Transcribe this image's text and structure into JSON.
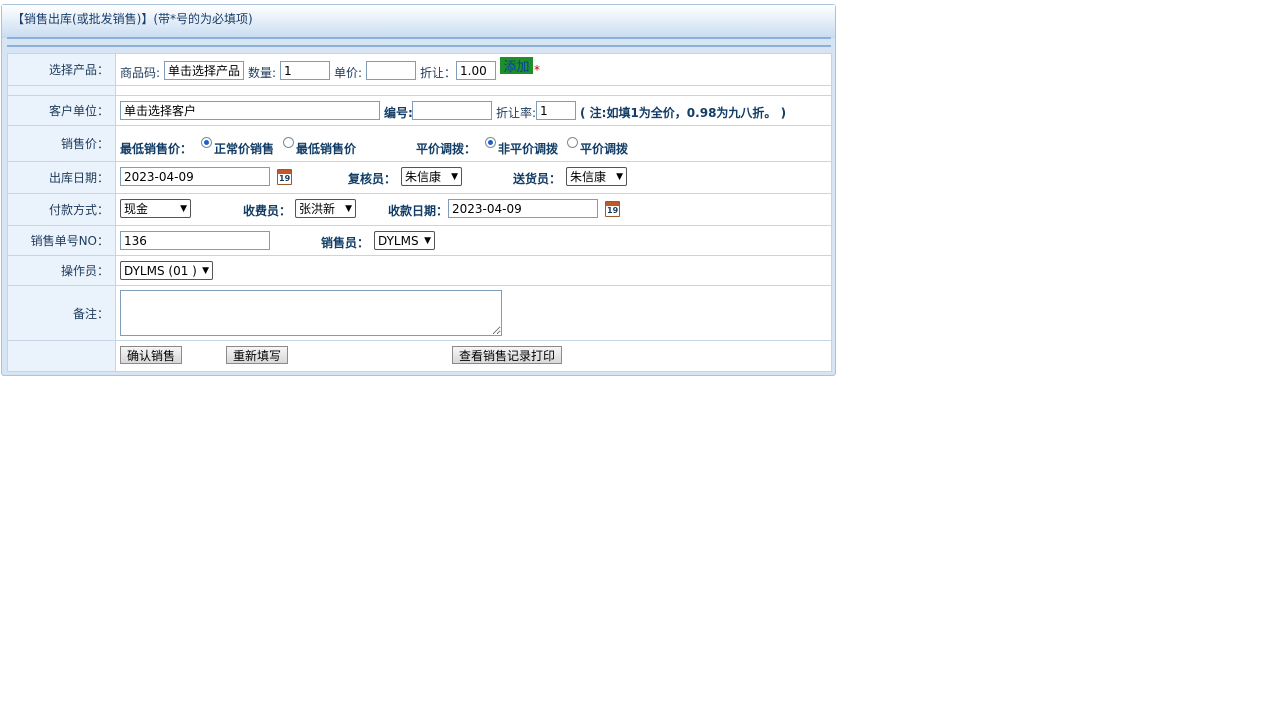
{
  "header": {
    "title": "【销售出库(或批发销售)】(带*号的为必填项)"
  },
  "rows": {
    "product": {
      "label": "选择产品：",
      "code_label": "商品码:",
      "code_value": "单击选择产品",
      "qty_label": "数量:",
      "qty_value": "1",
      "price_label": "单价:",
      "price_value": "",
      "discount_label": "折让：",
      "discount_value": "1.00",
      "add_label": "添加",
      "required_mark": "*"
    },
    "customer": {
      "label": "客户单位：",
      "value": "单击选择客户",
      "code_label": "编号:",
      "code_value": "",
      "rate_label": "折让率:",
      "rate_value": "1",
      "note": "( 注:如填1为全价，0.98为九八折。 )"
    },
    "sale_price": {
      "label": "销售价：",
      "min_label": "最低销售价：",
      "opt_normal": "正常价销售",
      "opt_min": "最低销售价",
      "transfer_label": "平价调拨：",
      "opt_nontransfer": "非平价调拨",
      "opt_transfer": "平价调拨"
    },
    "out_date": {
      "label": "出库日期：",
      "value": "2023-04-09",
      "reviewer_label": "复核员：",
      "reviewer_value": "朱信康",
      "deliverer_label": "送货员：",
      "deliverer_value": "朱信康"
    },
    "payment": {
      "label": "付款方式：",
      "method_value": "现金",
      "collector_label": "收费员：",
      "collector_value": "张洪新",
      "collect_date_label": "收款日期：",
      "collect_date_value": "2023-04-09"
    },
    "order_no": {
      "label": "销售单号NO：",
      "value": "136",
      "seller_label": "销售员：",
      "seller_value": "DYLMS"
    },
    "operator": {
      "label": "操作员：",
      "value": "DYLMS (01 )"
    },
    "remark": {
      "label": "备注：",
      "value": ""
    },
    "actions": {
      "confirm": "确认销售",
      "reset": "重新填写",
      "view_print": "查看销售记录打印"
    }
  },
  "calendar_icon_text": "19",
  "colors": {
    "accent": "#1f8f2a",
    "header": "#c8dcf1",
    "label_bg": "#eaf2fb"
  }
}
